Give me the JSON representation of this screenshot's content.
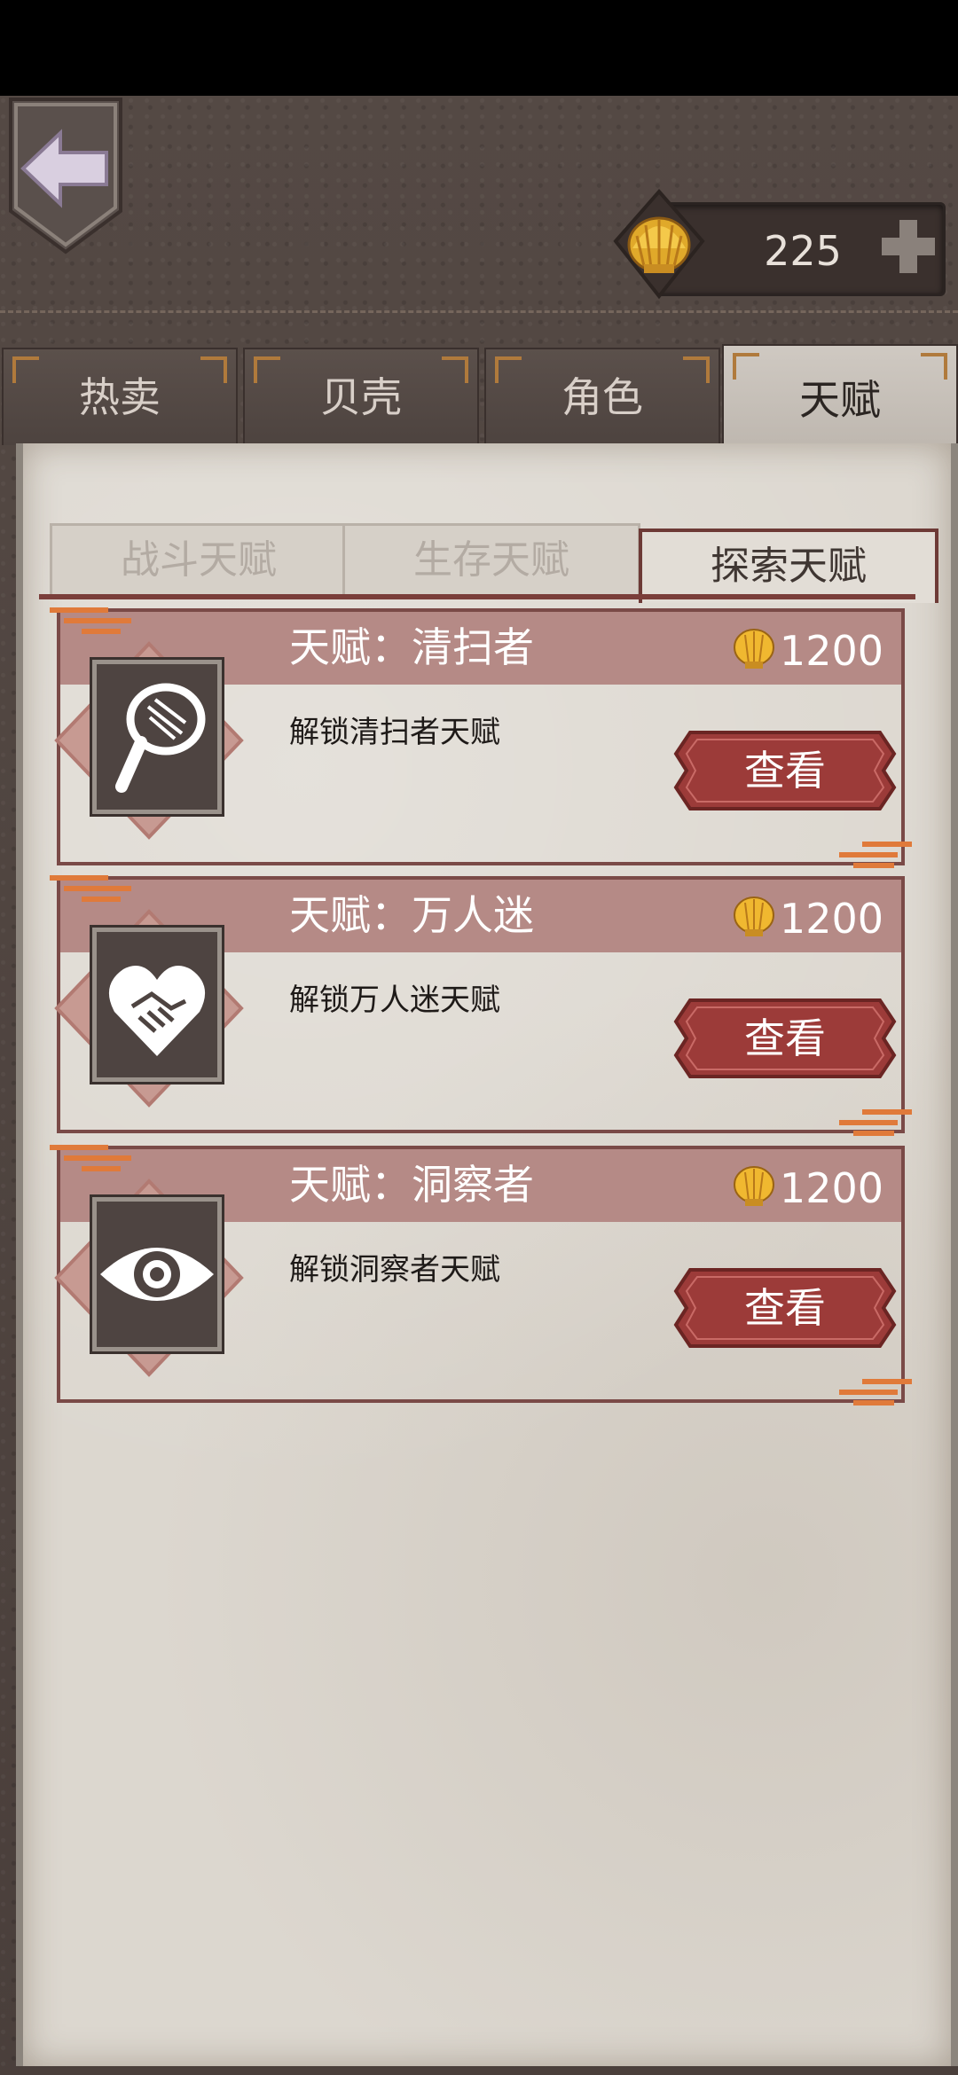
{
  "header": {
    "currency_value": "225"
  },
  "tabs": [
    {
      "label": "热卖"
    },
    {
      "label": "贝壳"
    },
    {
      "label": "角色"
    },
    {
      "label": "天赋"
    }
  ],
  "subtabs": [
    {
      "label": "战斗天赋"
    },
    {
      "label": "生存天赋"
    },
    {
      "label": "探索天赋"
    }
  ],
  "cards": [
    {
      "title": "天赋：清扫者",
      "price": "1200",
      "desc": "解锁清扫者天赋",
      "button": "查看",
      "icon": "magnifier-icon"
    },
    {
      "title": "天赋：万人迷",
      "price": "1200",
      "desc": "解锁万人迷天赋",
      "button": "查看",
      "icon": "heart-handshake-icon"
    },
    {
      "title": "天赋：洞察者",
      "price": "1200",
      "desc": "解锁洞察者天赋",
      "button": "查看",
      "icon": "eye-icon"
    }
  ],
  "colors": {
    "accent": "#9c3b39",
    "card_header": "#b58a86",
    "parchment": "#dcd7cf",
    "leather": "#4e4440"
  }
}
